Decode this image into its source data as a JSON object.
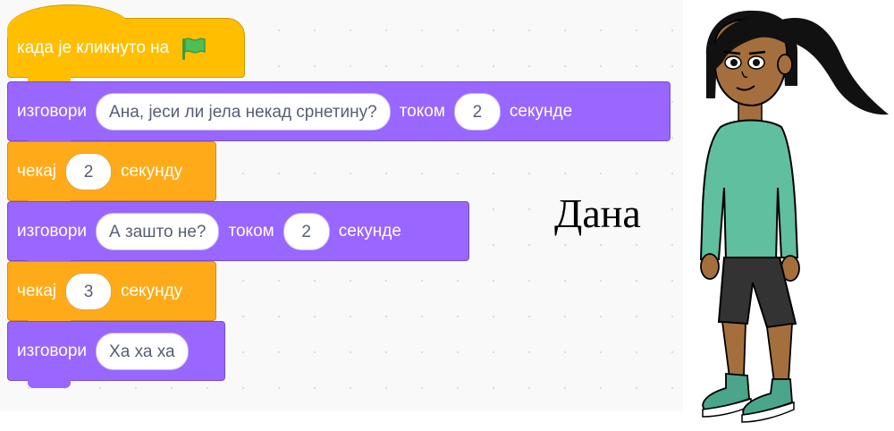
{
  "script_blocks": [
    {
      "id": "hat",
      "category": "events",
      "label": "када је кликнуто на",
      "icon": "green-flag-icon"
    },
    {
      "id": "say1",
      "category": "looks",
      "label": "изговори",
      "message": "Ана, јеси ли јела некад срнетину?",
      "connector": "током",
      "seconds": "2",
      "unit": "секунде"
    },
    {
      "id": "wait1",
      "category": "control",
      "label": "чекај",
      "seconds": "2",
      "unit": "секунду"
    },
    {
      "id": "say2",
      "category": "looks",
      "label": "изговори",
      "message": "А зашто не?",
      "connector": "током",
      "seconds": "2",
      "unit": "секунде"
    },
    {
      "id": "wait2",
      "category": "control",
      "label": "чекај",
      "seconds": "3",
      "unit": "секунду"
    },
    {
      "id": "say3",
      "category": "looks",
      "label": "изговори",
      "message": "Ха ха ха"
    }
  ],
  "sprite": {
    "name": "Дана",
    "icon": "girl-character"
  },
  "colors": {
    "looks": "#9966ff",
    "control": "#ffab19",
    "events": "#ffbf00",
    "shirt": "#5fbf9f",
    "shorts": "#333333",
    "skin": "#a56f3d"
  }
}
